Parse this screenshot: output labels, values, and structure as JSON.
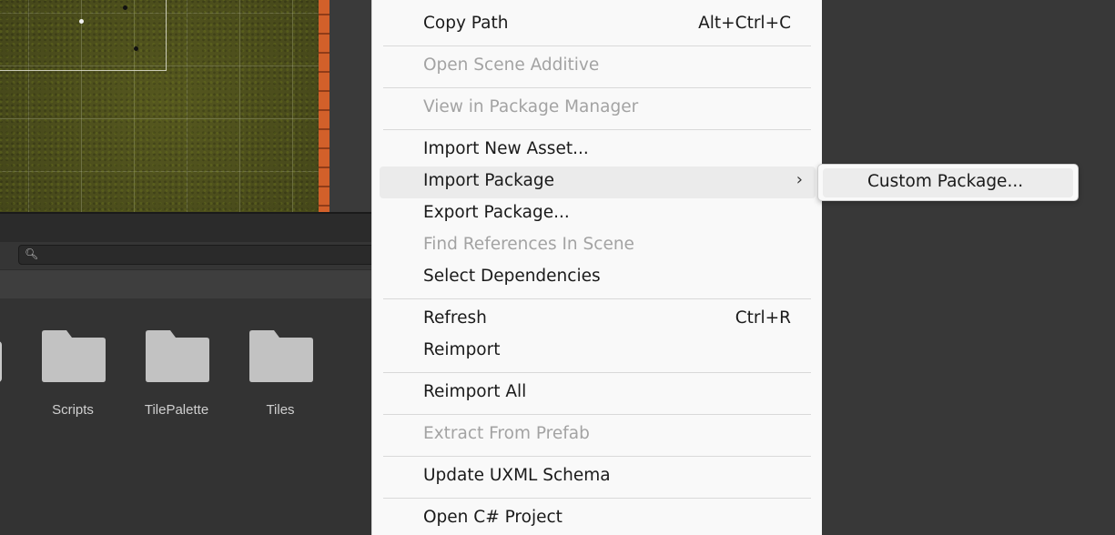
{
  "project_panel": {
    "folders": [
      {
        "name": "Scripts"
      },
      {
        "name": "TilePalette"
      },
      {
        "name": "Tiles"
      }
    ]
  },
  "context_menu": {
    "items": [
      {
        "label": "Copy Path",
        "shortcut": "Alt+Ctrl+C",
        "enabled": true
      },
      {
        "label": "Open Scene Additive",
        "enabled": false
      },
      {
        "label": "View in Package Manager",
        "enabled": false
      },
      {
        "label": "Import New Asset...",
        "enabled": true
      },
      {
        "label": "Import Package",
        "enabled": true,
        "has_submenu": true,
        "highlighted": true
      },
      {
        "label": "Export Package...",
        "enabled": true
      },
      {
        "label": "Find References In Scene",
        "enabled": false
      },
      {
        "label": "Select Dependencies",
        "enabled": true
      },
      {
        "label": "Refresh",
        "shortcut": "Ctrl+R",
        "enabled": true
      },
      {
        "label": "Reimport",
        "enabled": true
      },
      {
        "label": "Reimport All",
        "enabled": true
      },
      {
        "label": "Extract From Prefab",
        "enabled": false
      },
      {
        "label": "Update UXML Schema",
        "enabled": true
      },
      {
        "label": "Open C# Project",
        "enabled": true
      }
    ],
    "submenu_arrow": "›"
  },
  "submenu": {
    "items": [
      {
        "label": "Custom Package...",
        "enabled": true
      }
    ]
  },
  "icons": {
    "search": "search-icon",
    "folder": "folder-icon",
    "submenu_arrow": "chevron-right-icon"
  },
  "colors": {
    "menu_background": "#f9f9f9",
    "menu_text": "#1a1a1a",
    "menu_disabled_text": "#a3a3a3",
    "menu_highlight": "#ebebeb",
    "editor_background": "#383838",
    "scene_wall": "#d2602a"
  }
}
